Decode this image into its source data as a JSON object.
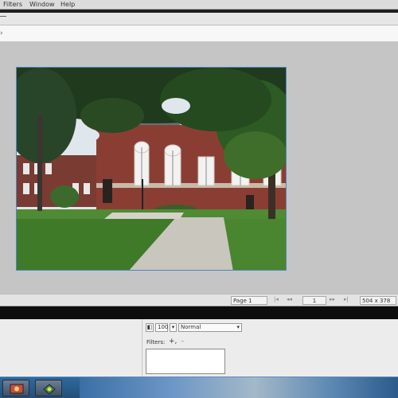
{
  "menu": {
    "items": [
      "Filters",
      "Window",
      "Help"
    ]
  },
  "statusbar": {
    "page_label": "Page 1",
    "page_number": "1",
    "dimensions": "504 x 378"
  },
  "panel": {
    "size_value": "100",
    "blend_mode": "Normal",
    "filters_label": "Filters:",
    "add_symbol": "+,",
    "remove_symbol": "–"
  },
  "icons": {
    "options_arrow": "chevron-icon",
    "nav": [
      "first-page-icon",
      "prev-page-icon",
      "next-page-icon",
      "last-page-icon"
    ]
  }
}
